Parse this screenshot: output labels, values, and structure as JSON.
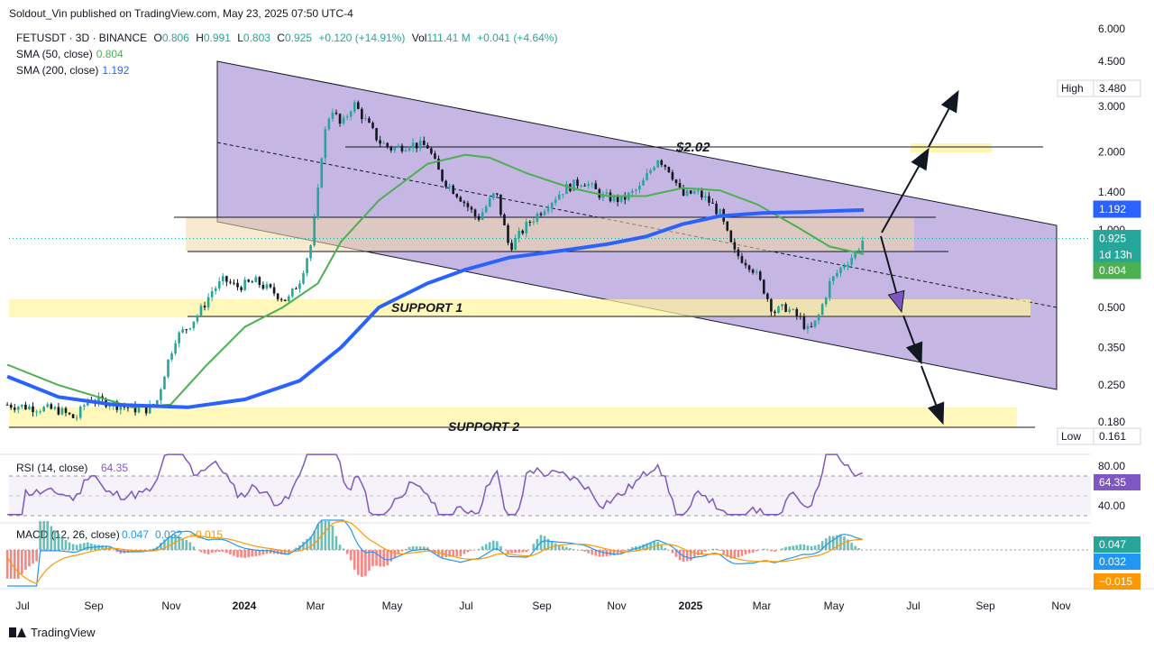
{
  "header": {
    "published": "Soldout_Vin published on TradingView.com, May 23, 2025 07:50 UTC-4"
  },
  "legend": {
    "symbol": "FETUSDT · 3D · BINANCE",
    "o_label": "O",
    "o": "0.806",
    "h_label": "H",
    "h": "0.991",
    "l_label": "L",
    "l": "0.803",
    "c_label": "C",
    "c": "0.925",
    "change": "+0.120 (+14.91%)",
    "vol_label": "Vol",
    "vol": "111.41 M",
    "vol_change": "+0.041 (+4.64%)",
    "sma50_label": "SMA (50, close)",
    "sma50_value": "0.804",
    "sma200_label": "SMA (200, close)",
    "sma200_value": "1.192"
  },
  "footer": {
    "brand": "TradingView"
  },
  "colors": {
    "up": "#26a69a",
    "down": "#131722",
    "sma50": "#4caf50",
    "sma200": "#2962ff",
    "channel": "#b39ddb",
    "zone": "#fff59d",
    "rsi": "#7e57c2",
    "macd": "#2196f3",
    "signal": "#ff9800"
  },
  "chart_data": {
    "type": "candlestick",
    "ytick_labels": [
      "6.000",
      "4.500",
      "3.000",
      "2.000",
      "1.400",
      "1.000",
      "0.500",
      "0.350",
      "0.250",
      "0.180"
    ],
    "ytick_values": [
      6.0,
      4.5,
      3.0,
      2.0,
      1.4,
      1.0,
      0.5,
      0.35,
      0.25,
      0.18
    ],
    "xtick_labels": [
      "Jul",
      "Sep",
      "Nov",
      "2024",
      "Mar",
      "May",
      "Jul",
      "Sep",
      "Nov",
      "2025",
      "Mar",
      "May",
      "Jul",
      "Sep",
      "Nov"
    ],
    "price_badges": [
      {
        "label": "High",
        "value": "3.480"
      },
      {
        "label": "",
        "value": "1.192"
      },
      {
        "label": "",
        "value": "0.925"
      },
      {
        "label": "",
        "value": "1d 13h"
      },
      {
        "label": "",
        "value": "0.804"
      },
      {
        "label": "Low",
        "value": "0.161"
      }
    ],
    "annotations": {
      "target": "$2.02",
      "support1": "SUPPORT 1",
      "support2": "SUPPORT 2"
    },
    "price_path": [
      [
        "2023-06-20",
        0.21
      ],
      [
        "2023-07-10",
        0.205
      ],
      [
        "2023-08-01",
        0.2
      ],
      [
        "2023-08-15",
        0.185
      ],
      [
        "2023-08-25",
        0.22
      ],
      [
        "2023-09-10",
        0.215
      ],
      [
        "2023-09-25",
        0.205
      ],
      [
        "2023-10-10",
        0.2
      ],
      [
        "2023-10-20",
        0.21
      ],
      [
        "2023-10-28",
        0.29
      ],
      [
        "2023-11-05",
        0.38
      ],
      [
        "2023-11-15",
        0.42
      ],
      [
        "2023-11-25",
        0.48
      ],
      [
        "2023-12-05",
        0.58
      ],
      [
        "2023-12-15",
        0.64
      ],
      [
        "2023-12-25",
        0.6
      ],
      [
        "2024-01-10",
        0.63
      ],
      [
        "2024-01-25",
        0.57
      ],
      [
        "2024-02-05",
        0.53
      ],
      [
        "2024-02-15",
        0.64
      ],
      [
        "2024-02-25",
        0.9
      ],
      [
        "2024-03-01",
        1.4
      ],
      [
        "2024-03-05",
        2.2
      ],
      [
        "2024-03-12",
        3.0
      ],
      [
        "2024-03-20",
        2.5
      ],
      [
        "2024-03-30",
        3.1
      ],
      [
        "2024-04-10",
        2.6
      ],
      [
        "2024-04-20",
        2.2
      ],
      [
        "2024-05-01",
        2.05
      ],
      [
        "2024-05-15",
        2.15
      ],
      [
        "2024-05-30",
        2.1
      ],
      [
        "2024-06-10",
        1.6
      ],
      [
        "2024-06-25",
        1.35
      ],
      [
        "2024-07-10",
        1.1
      ],
      [
        "2024-07-25",
        1.4
      ],
      [
        "2024-08-05",
        0.85
      ],
      [
        "2024-08-20",
        1.05
      ],
      [
        "2024-09-05",
        1.25
      ],
      [
        "2024-09-20",
        1.45
      ],
      [
        "2024-10-05",
        1.55
      ],
      [
        "2024-10-20",
        1.35
      ],
      [
        "2024-11-05",
        1.3
      ],
      [
        "2024-11-20",
        1.45
      ],
      [
        "2024-12-05",
        1.9
      ],
      [
        "2024-12-15",
        1.7
      ],
      [
        "2024-12-25",
        1.35
      ],
      [
        "2025-01-05",
        1.4
      ],
      [
        "2025-01-15",
        1.3
      ],
      [
        "2025-01-25",
        1.15
      ],
      [
        "2025-02-05",
        0.82
      ],
      [
        "2025-02-20",
        0.72
      ],
      [
        "2025-03-01",
        0.6
      ],
      [
        "2025-03-10",
        0.48
      ],
      [
        "2025-03-20",
        0.5
      ],
      [
        "2025-04-01",
        0.45
      ],
      [
        "2025-04-08",
        0.4
      ],
      [
        "2025-04-15",
        0.45
      ],
      [
        "2025-04-25",
        0.62
      ],
      [
        "2025-05-05",
        0.72
      ],
      [
        "2025-05-15",
        0.8
      ],
      [
        "2025-05-23",
        0.925
      ]
    ],
    "sma50": [
      [
        "2023-06-20",
        0.3
      ],
      [
        "2023-08-01",
        0.25
      ],
      [
        "2023-10-01",
        0.205
      ],
      [
        "2023-11-01",
        0.21
      ],
      [
        "2023-12-01",
        0.3
      ],
      [
        "2024-01-01",
        0.42
      ],
      [
        "2024-02-01",
        0.5
      ],
      [
        "2024-03-01",
        0.62
      ],
      [
        "2024-03-20",
        0.9
      ],
      [
        "2024-04-20",
        1.3
      ],
      [
        "2024-05-30",
        1.8
      ],
      [
        "2024-06-30",
        1.95
      ],
      [
        "2024-07-20",
        1.9
      ],
      [
        "2024-08-20",
        1.65
      ],
      [
        "2024-09-25",
        1.45
      ],
      [
        "2024-10-25",
        1.35
      ],
      [
        "2024-11-25",
        1.35
      ],
      [
        "2024-12-25",
        1.45
      ],
      [
        "2025-01-25",
        1.42
      ],
      [
        "2025-02-25",
        1.25
      ],
      [
        "2025-03-30",
        1.02
      ],
      [
        "2025-04-25",
        0.86
      ],
      [
        "2025-05-23",
        0.804
      ]
    ],
    "sma200": [
      [
        "2023-06-20",
        0.27
      ],
      [
        "2023-08-01",
        0.225
      ],
      [
        "2023-09-15",
        0.21
      ],
      [
        "2023-11-15",
        0.205
      ],
      [
        "2024-01-01",
        0.22
      ],
      [
        "2024-02-15",
        0.26
      ],
      [
        "2024-03-20",
        0.35
      ],
      [
        "2024-04-20",
        0.5
      ],
      [
        "2024-05-30",
        0.62
      ],
      [
        "2024-06-30",
        0.7
      ],
      [
        "2024-08-05",
        0.78
      ],
      [
        "2024-09-25",
        0.84
      ],
      [
        "2024-10-25",
        0.88
      ],
      [
        "2024-11-25",
        0.94
      ],
      [
        "2024-12-25",
        1.05
      ],
      [
        "2025-01-25",
        1.13
      ],
      [
        "2025-03-01",
        1.16
      ],
      [
        "2025-04-01",
        1.17
      ],
      [
        "2025-05-23",
        1.192
      ]
    ],
    "rsi": {
      "label": "RSI (14, close)",
      "value": "64.35",
      "tick_labels": [
        "80.00",
        "40.00"
      ],
      "ylim": [
        20,
        90
      ]
    },
    "macd": {
      "label": "MACD (12, 26, close)",
      "macd": "0.047",
      "signal": "0.032",
      "hist": "−0.015"
    }
  }
}
